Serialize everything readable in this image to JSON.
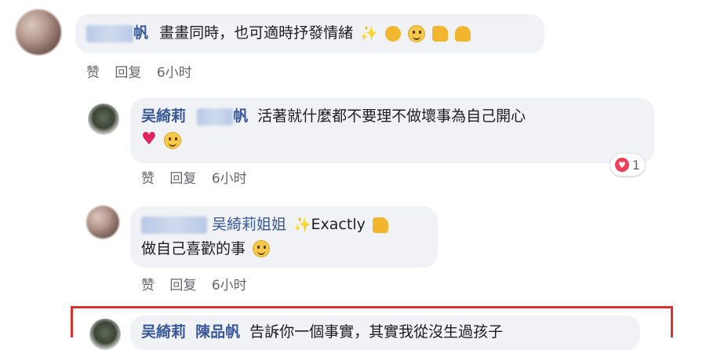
{
  "comment1": {
    "name_suffix": "帆",
    "text": "畫畫同時，也可適時抒發情緒",
    "actions": {
      "like": "赞",
      "reply": "回复",
      "time": "6小时"
    }
  },
  "reply1": {
    "author": "吴綺莉",
    "mention_suffix": "帆",
    "text_line1": "活著就什麼都不要理不做壞事為自己開心",
    "reaction_count": "1",
    "actions": {
      "like": "赞",
      "reply": "回复",
      "time": "6小时"
    }
  },
  "reply2": {
    "mention": "吴綺莉姐姐",
    "text_line1_suffix": "Exactly",
    "text_line2": "做自己喜歡的事",
    "actions": {
      "like": "赞",
      "reply": "回复",
      "time": "6小时"
    }
  },
  "reply3": {
    "author": "吴綺莉",
    "mention": "陳品帆",
    "text": "告訴你一個事實，其實我從沒生過孩子"
  },
  "colors": {
    "name": "#385898",
    "bubble": "#f0f2f5",
    "highlight_border": "#d8342f"
  }
}
